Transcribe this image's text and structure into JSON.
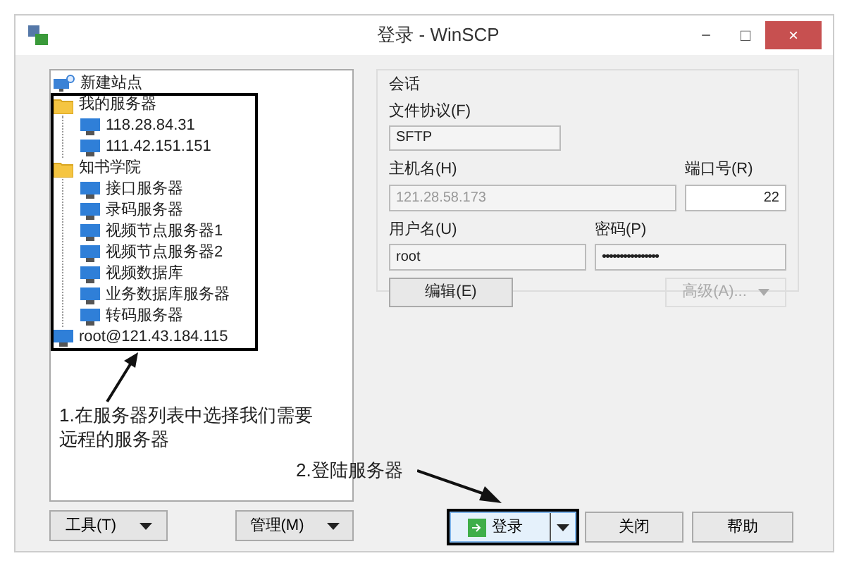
{
  "window": {
    "title": "登录 - WinSCP",
    "controls": [
      "−",
      "□",
      "×"
    ]
  },
  "tree": [
    {
      "label": "新建站点",
      "kind": "new-site"
    },
    {
      "label": "我的服务器",
      "kind": "folder",
      "children": [
        {
          "label": "118.28.84.31",
          "kind": "server"
        },
        {
          "label": "111.42.151.151",
          "kind": "server"
        }
      ]
    },
    {
      "label": "知书学院",
      "kind": "folder",
      "children": [
        {
          "label": "接口服务器",
          "kind": "server"
        },
        {
          "label": "录码服务器",
          "kind": "server"
        },
        {
          "label": "视频节点服务器1",
          "kind": "server"
        },
        {
          "label": "视频节点服务器2",
          "kind": "server"
        },
        {
          "label": "视频数据库",
          "kind": "server"
        },
        {
          "label": "业务数据库服务器",
          "kind": "server"
        },
        {
          "label": "转码服务器",
          "kind": "server"
        }
      ]
    },
    {
      "label": "root@121.43.184.115",
      "kind": "server"
    }
  ],
  "session": {
    "title": "会话",
    "protocol_label": "文件协议(F)",
    "protocol": "SFTP",
    "host_label": "主机名(H)",
    "host": "121.28.58.173",
    "port_label": "端口号(R)",
    "port": "22",
    "user_label": "用户名(U)",
    "user": "root",
    "password_label": "密码(P)",
    "password": "••••••••••••••••",
    "edit_button": "编辑(E)",
    "advanced_button": "高级(A)...",
    "advanced_disabled": true
  },
  "annotations": {
    "step1": "1.在服务器列表中选择我们需要远程的服务器",
    "step2": "2.登陆服务器"
  },
  "buttons": {
    "tools": "工具(T)",
    "manage": "管理(M)",
    "login": "登录",
    "close": "关闭",
    "help": "帮助"
  }
}
